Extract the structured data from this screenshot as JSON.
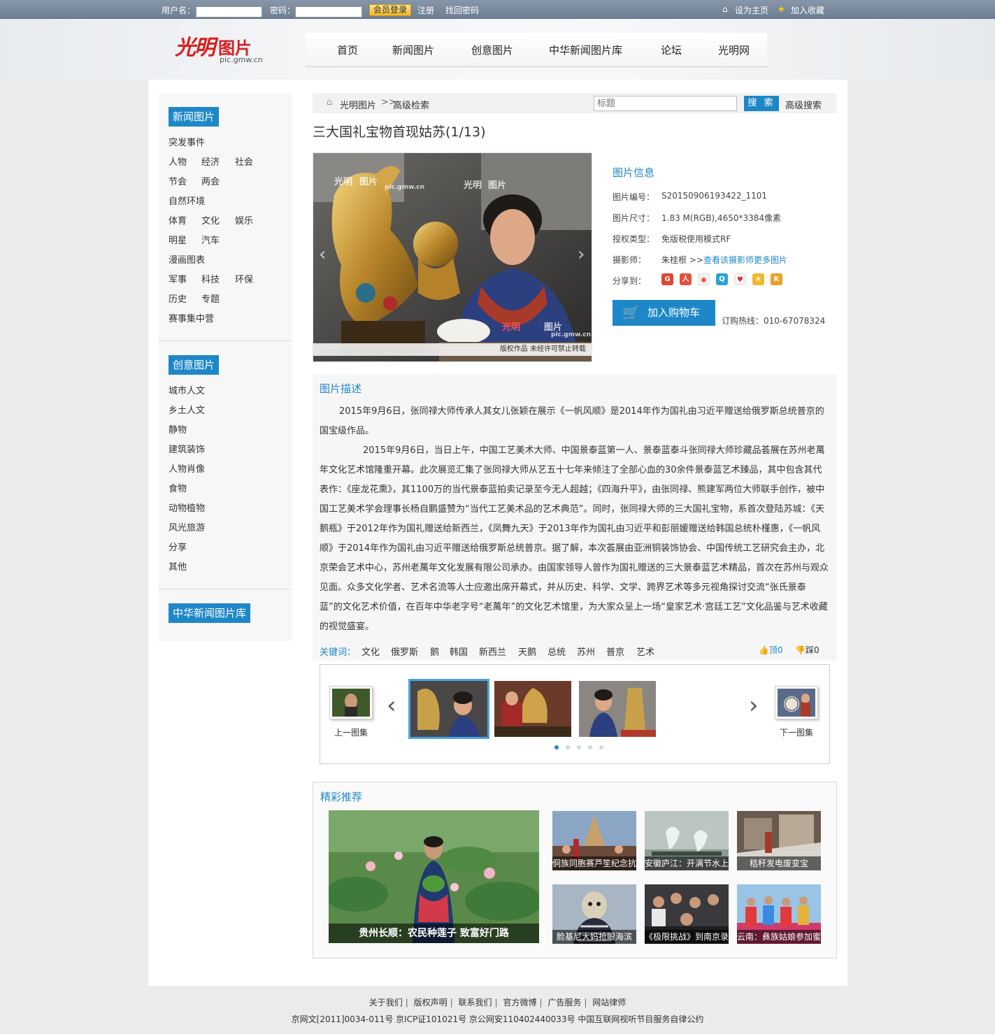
{
  "topbar": {
    "username_label": "用户名：",
    "password_label": "密码：",
    "login_button": "会员登录",
    "register": "注册",
    "recover_password": "找回密码",
    "set_homepage": "设为主页",
    "add_favorite": "加入收藏"
  },
  "logo": {
    "mark": "光明",
    "text": "图片",
    "domain": "pic.gmw.cn"
  },
  "nav": [
    "首页",
    "新闻图片",
    "创意图片",
    "中华新闻图片库",
    "论坛",
    "光明网"
  ],
  "sidebar": {
    "news_head": "新闻图片",
    "news_links": [
      "突发事件",
      "人物",
      "经济",
      "社会",
      "节会",
      "两会",
      "自然环境",
      "体育",
      "文化",
      "娱乐",
      "明星",
      "汽车",
      "漫画图表",
      "军事",
      "科技",
      "环保",
      "历史",
      "专题",
      "赛事集中营"
    ],
    "creative_head": "创意图片",
    "creative_links": [
      "城市人文",
      "乡土人文",
      "静物",
      "建筑装饰",
      "人物肖像",
      "食物",
      "动物植物",
      "风光旅游",
      "分享",
      "其他"
    ],
    "library_head": "中华新闻图片库"
  },
  "breadcrumb": {
    "home": "光明图片",
    "current": "高级检索",
    "separator": ">>"
  },
  "search": {
    "placeholder": "标题",
    "button": "搜 索",
    "advanced": "高级搜索"
  },
  "title": "三大国礼宝物首现姑苏(1/13)",
  "photo": {
    "watermark_mark": "光明",
    "watermark_text": "图片",
    "watermark_domain": "pic.gmw.cn",
    "copyright": "版权作品   未经许可禁止转载"
  },
  "info": {
    "head": "图片信息",
    "rows": [
      {
        "label": "图片编号：",
        "value": "S20150906193422_1101"
      },
      {
        "label": "图片尺寸：",
        "value": "1.83 M(RGB),4650*3384像素"
      },
      {
        "label": "授权类型：",
        "value": "免版税使用模式RF"
      },
      {
        "label": "摄影师：",
        "value": "朱桂根 >>"
      }
    ],
    "photographer_more": "查看该摄影师更多图片",
    "share_label": "分享到：",
    "share_icons": [
      "google-icon",
      "renren-icon",
      "weibo-icon",
      "tencent-icon",
      "baidu-icon",
      "qzone-icon",
      "kaixin-icon"
    ],
    "cart_button": "加入购物车",
    "hotline": "订购热线：010-67078324"
  },
  "description": {
    "head": "图片描述",
    "paragraphs": [
      "2015年9月6日，张同禄大师传承人其女儿张颖在展示《一帆风顺》是2014年作为国礼由习近平赠送给俄罗斯总统普京的国宝级作品。",
      "2015年9月6日，当日上午，中国工艺美术大师、中国景泰蓝第一人、景泰蓝泰斗张同禄大师珍藏品荟展在苏州老萬年文化艺术馆隆重开幕。此次展览汇集了张同禄大师从艺五十七年来倾注了全部心血的30余件景泰蓝艺术臻品，其中包含其代表作：《座龙花熏》，其1100万的当代景泰蓝拍卖记录至今无人超越；《四海升平》，由张同禄、熊建军两位大师联手创作，被中国工艺美术学会理事长杨自鹏盛赞为“当代工艺美术品的艺术典范”。同时，张同禄大师的三大国礼宝物，系首次登陆苏城：《天鹅瓶》于2012年作为国礼赠送给新西兰，《凤舞九天》于2013年作为国礼由习近平和彭丽媛赠送给韩国总统朴槿惠，《一帆风顺》于2014年作为国礼由习近平赠送给俄罗斯总统普京。据了解，本次荟展由亚洲铜装饰协会、中国传统工艺研究会主办，北京荣会艺术中心，苏州老萬年文化发展有限公司承办。由国家领导人曾作为国礼赠送的三大景泰蓝艺术精品，首次在苏州与观众见面。众多文化学者、艺术名流等人士应邀出席开幕式，并从历史、科学、文学、跨界艺术等多元视角探讨交流“张氏景泰蓝”的文化艺术价值，在百年中华老字号“老萬年”的文化艺术馆里，为大家众呈上一场“皇家艺术·宫廷工艺”文化品鉴与艺术收藏的视觉盛宴。"
    ]
  },
  "keywords": {
    "label": "关键词：",
    "items": [
      "文化",
      "俄罗斯",
      "鹅",
      "韩国",
      "新西兰",
      "天鹅",
      "总统",
      "苏州",
      "普京",
      "艺术"
    ],
    "vote_up": "顶0",
    "vote_down": "踩0"
  },
  "carousel": {
    "prev_set": "上一图集",
    "next_set": "下一图集",
    "thumb_count": 4,
    "dot_count": 5,
    "active_dot": 0
  },
  "recommend": {
    "head": "精彩推荐",
    "big_caption": "贵州长顺：农民种莲子 致富好门路",
    "items": [
      "侗族同胞赛芦笙纪念抗",
      "安徽庐江：开满节水上",
      "秸秆发电废变宝",
      "脸基尼大妈抢眼海滨",
      "《极限挑战》到南京录",
      "云南：彝族姑娘参加蜜"
    ]
  },
  "footer": {
    "links": [
      "关于我们",
      "版权声明",
      "联系我们",
      "官方微博",
      "广告服务",
      "网站律师"
    ],
    "icp": "京网文[2011]0034-011号  京ICP证101021号  京公网安110402440033号  中国互联网视听节目服务自律公约"
  },
  "colors": {
    "accent": "#1e87c8",
    "topbar": "#7a8a9e",
    "logo_red": "#d81e1e"
  }
}
